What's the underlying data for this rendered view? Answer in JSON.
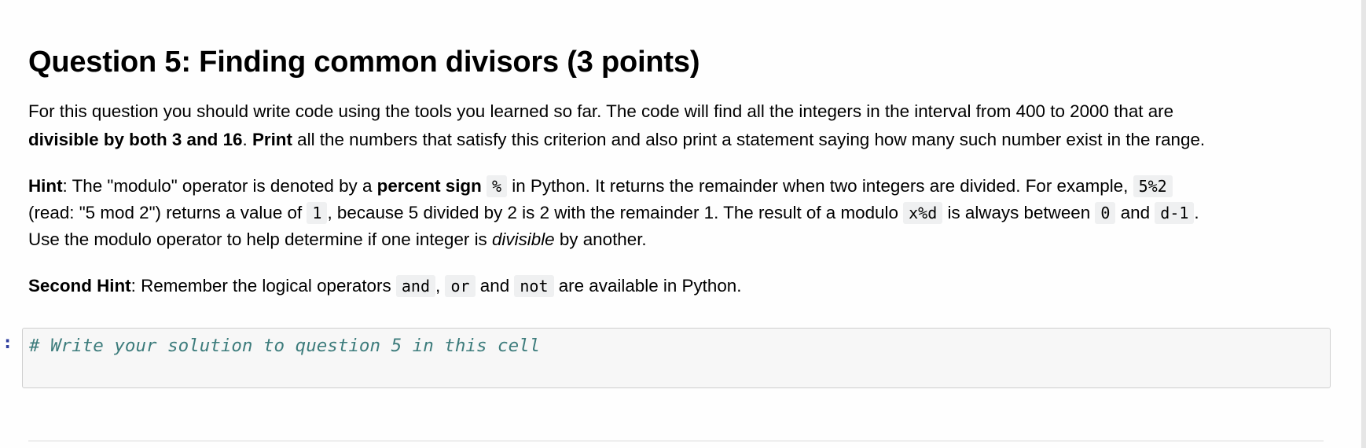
{
  "heading": "Question 5: Finding common divisors (3 points)",
  "paragraph1": {
    "line1": "For this question you should write code using the tools you learned so far. The code will find all the integers in the interval from 400 to 2000 that are",
    "line2_bold1": "divisible by both 3 and 16",
    "line2_sep": ". ",
    "line2_bold2": "Print",
    "line2_rest": " all the numbers that satisfy this criterion and also print a statement saying how many such number exist in the range."
  },
  "hint": {
    "label": "Hint",
    "t1": ": The \"modulo\" operator is denoted by a ",
    "bold1": "percent sign",
    "code1": "%",
    "t2": " in Python. It returns the remainder when two integers are divided. For example, ",
    "code2": "5%2",
    "t3": "(read: \"5 mod 2\") returns a value of ",
    "code3": "1",
    "t4": ", because 5 divided by 2 is 2 with the remainder 1. The result of a modulo ",
    "code4": "x%d",
    "t5": " is always between ",
    "code5": "0",
    "t6": " and ",
    "code6": "d-1",
    "t7": ".",
    "t8": "Use the modulo operator to help determine if one integer is ",
    "em1": "divisible",
    "t9": " by another."
  },
  "second_hint": {
    "label": "Second Hint",
    "t1": ": Remember the logical operators ",
    "code1": "and",
    "t2": ", ",
    "code2": "or",
    "t3": " and ",
    "code3": "not",
    "t4": " are available in Python."
  },
  "code_cell": {
    "prompt": ":",
    "source": "# Write your solution to question 5 in this cell"
  },
  "colors": {
    "prompt": "#303f9f",
    "comment": "#3d7c7c",
    "code_bg": "#f7f7f7",
    "inline_code_bg": "#eff0f1"
  }
}
